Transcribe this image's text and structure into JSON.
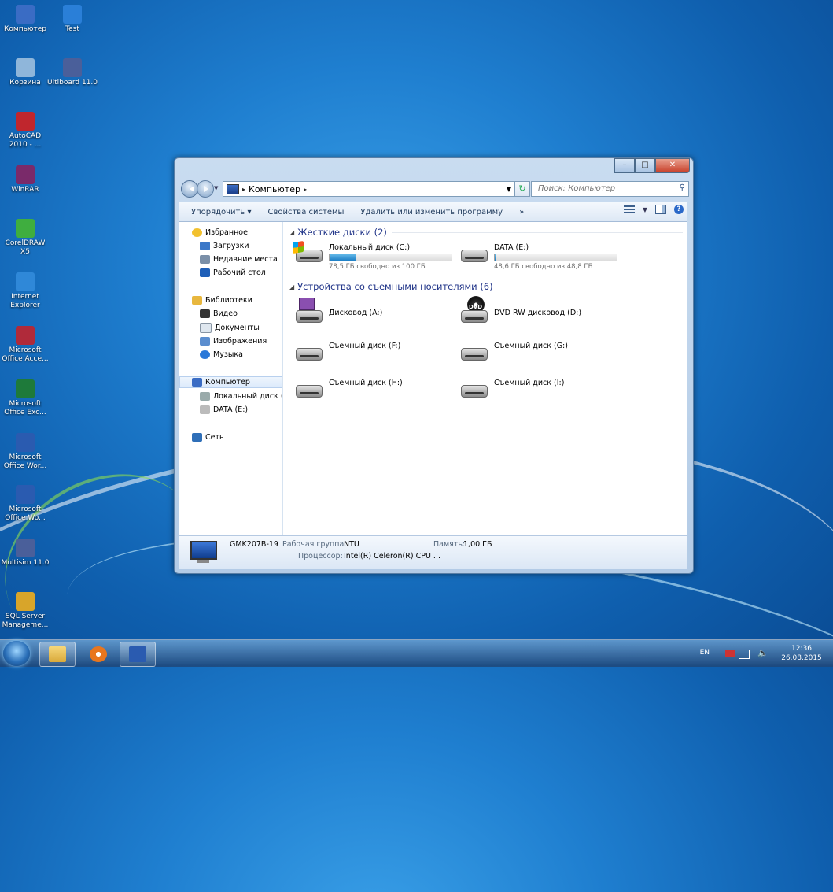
{
  "desktop": {
    "icons": [
      {
        "label": "Компьютер",
        "color": "#3a6cc4"
      },
      {
        "label": "Test",
        "color": "#2a7fd8"
      },
      {
        "label": "Корзина",
        "color": "#8fb6da"
      },
      {
        "label": "Ultiboard 11.0",
        "color": "#4a5f9a"
      },
      {
        "label": "AutoCAD 2010 - ...",
        "color": "#c0262d"
      },
      {
        "label": "WinRAR",
        "color": "#7a2a6a"
      },
      {
        "label": "CorelDRAW X5",
        "color": "#3fae3f"
      },
      {
        "label": "Internet Explorer",
        "color": "#2f88d8"
      },
      {
        "label": "Microsoft Office Acce...",
        "color": "#b02a3a"
      },
      {
        "label": "Microsoft Office Exc...",
        "color": "#1e7a3a"
      },
      {
        "label": "Microsoft Office Wor...",
        "color": "#2a5bb0"
      },
      {
        "label": "Microsoft Office Wo...",
        "color": "#2a5bb0"
      },
      {
        "label": "Multisim 11.0",
        "color": "#4a5f9a"
      },
      {
        "label": "SQL Server Manageme...",
        "color": "#d8a52a"
      }
    ]
  },
  "window": {
    "controls": {
      "minimize": "–",
      "maximize": "□",
      "close": "✕"
    },
    "address": {
      "breadcrumb": "Компьютер",
      "separator": "▸"
    },
    "search": {
      "placeholder": "Поиск: Компьютер"
    },
    "toolbar": {
      "organize": "Упорядочить ▾",
      "system_properties": "Свойства системы",
      "uninstall": "Удалить или изменить программу",
      "more": "»"
    },
    "nav": {
      "favorites": "Избранное",
      "downloads": "Загрузки",
      "recent": "Недавние места",
      "desktop": "Рабочий стол",
      "libraries": "Библиотеки",
      "video": "Видео",
      "documents": "Документы",
      "images": "Изображения",
      "music": "Музыка",
      "computer": "Компьютер",
      "local_disk": "Локальный диск (C",
      "data_disk": "DATA (E:)",
      "network": "Сеть"
    },
    "groups": {
      "hard_disks": "Жесткие диски (2)",
      "removable": "Устройства со съемными носителями (6)"
    },
    "drives": {
      "c": {
        "name": "Локальный диск (C:)",
        "free": "78,5 ГБ свободно из 100 ГБ",
        "used_fraction": 0.215
      },
      "e": {
        "name": "DATA (E:)",
        "free": "48,6 ГБ свободно из 48,8 ГБ",
        "used_fraction": 0.004
      },
      "a": {
        "name": "Дисковод (A:)"
      },
      "d": {
        "name": "DVD RW дисковод (D:)",
        "badge": "DVD"
      },
      "f": {
        "name": "Съемный диск (F:)"
      },
      "g": {
        "name": "Съемный диск (G:)"
      },
      "h": {
        "name": "Съемный диск (H:)"
      },
      "i": {
        "name": "Съемный диск (I:)"
      }
    },
    "status": {
      "computer_name": "GMK207B-19",
      "workgroup_label": "Рабочая группа:",
      "workgroup_value": "NTU",
      "memory_label": "Память:",
      "memory_value": "1,00 ГБ",
      "cpu_label": "Процессор:",
      "cpu_value": "Intel(R) Celeron(R) CPU ..."
    }
  },
  "taskbar": {
    "lang": "EN",
    "volume_icon": "🔈",
    "time": "12:36",
    "date": "26.08.2015"
  }
}
